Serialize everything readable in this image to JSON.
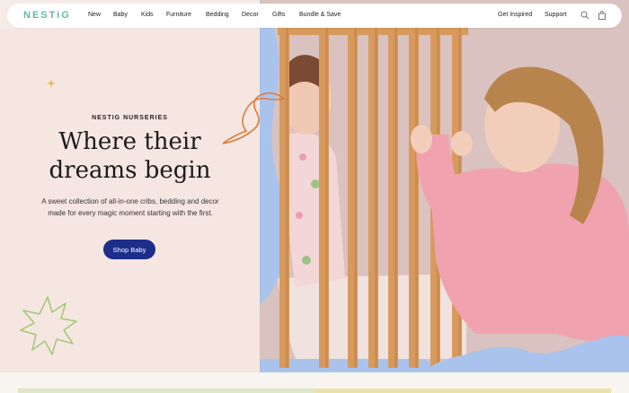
{
  "brand": {
    "logo_text": "NESTiG",
    "logo_color": "#66b7a9"
  },
  "nav": {
    "items": [
      "New",
      "Baby",
      "Kids",
      "Furniture",
      "Bedding",
      "Decor",
      "Gifts",
      "Bundle & Save"
    ],
    "right_items": [
      "Get Inspired",
      "Support"
    ],
    "icons": [
      "search-icon",
      "bag-icon"
    ]
  },
  "hero": {
    "eyebrow": "NESTIG NURSERIES",
    "headline_line1": "Where their",
    "headline_line2": "dreams begin",
    "subcopy": "A sweet collection of all-in-one cribs, bedding and decor made for every magic moment starting with the first.",
    "cta_label": "Shop Baby"
  },
  "colors": {
    "hero_bg": "#f6e6e1",
    "photo_bg": "#a9c3ec",
    "cta_bg": "#1d2d8a",
    "accent_orange": "#e07a3a",
    "accent_green": "#a5c97a",
    "accent_yellow": "#e8b73c"
  }
}
